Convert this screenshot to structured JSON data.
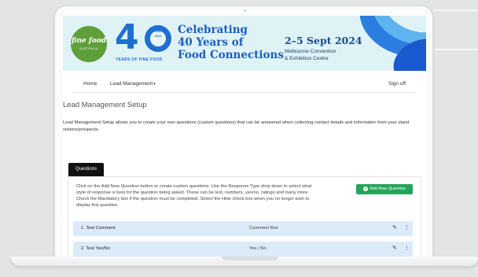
{
  "banner": {
    "logo_main": "fine food",
    "logo_sub": "AUSTRALIA",
    "forty": "4",
    "years_top": "1984",
    "years_bottom": "2024",
    "years_of": "YEARS OF FINE FOOD",
    "celebrate_line1": "Celebrating",
    "celebrate_line2": "40 Years of",
    "celebrate_line3": "Food Connections",
    "date": "2–5 Sept 2024",
    "venue_line1": "Melbourne Convention",
    "venue_line2": "& Exhibition Centre"
  },
  "nav": {
    "home": "Home",
    "lead_management": "Lead Management",
    "signoff": "Sign off"
  },
  "page": {
    "title": "Lead Management Setup",
    "description": "Lead Management Setup allows you to create your own questions (custom questions) that can be answered when collecting contact details and information from your stand visitors/prospects."
  },
  "tabs": {
    "questions": "Questions"
  },
  "panel": {
    "help": "Click on the Add New Question button to create custom questions. Use the Response Type drop down to select what style of response is best for the question being asked. These can be text, numbers, yes/no, ratings and many more. Check the Mandatory box if the question must be completed. Select the Hide check box when you no longer wish to display this question.",
    "add_button": "Add New Question"
  },
  "questions": [
    {
      "name": "1. Test Comment",
      "type": "Comment Box"
    },
    {
      "name": "2. Test Yes/No",
      "type": "Yes / No"
    }
  ],
  "colors": {
    "accent_blue": "#1f6fd1",
    "button_green": "#25a45a",
    "row_blue": "#dcebfa"
  },
  "icons": {
    "add": "plus-circle-icon",
    "edit": "edit-icon",
    "more": "vertical-ellipsis-icon",
    "dropdown": "caret-down-icon"
  }
}
